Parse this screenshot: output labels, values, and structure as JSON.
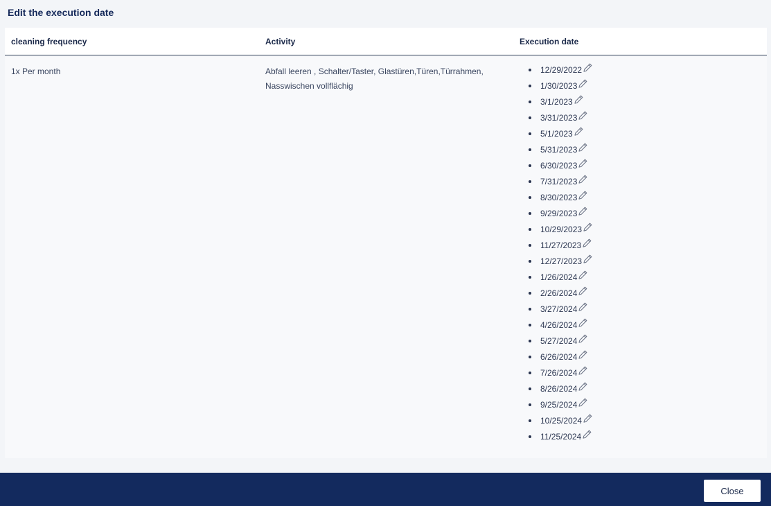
{
  "modal": {
    "title": "Edit the execution date"
  },
  "table": {
    "headers": {
      "frequency": "cleaning frequency",
      "activity": "Activity",
      "execution_date": "Execution date"
    },
    "row": {
      "frequency": "1x Per month",
      "activity_line1": "Abfall leeren , Schalter/Taster, Glastüren,Türen,Türrahmen,",
      "activity_line2": "Nasswischen vollflächig"
    },
    "dates": [
      "12/29/2022",
      "1/30/2023",
      "3/1/2023",
      "3/31/2023",
      "5/1/2023",
      "5/31/2023",
      "6/30/2023",
      "7/31/2023",
      "8/30/2023",
      "9/29/2023",
      "10/29/2023",
      "11/27/2023",
      "12/27/2023",
      "1/26/2024",
      "2/26/2024",
      "3/27/2024",
      "4/26/2024",
      "5/27/2024",
      "6/26/2024",
      "7/26/2024",
      "8/26/2024",
      "9/25/2024",
      "10/25/2024",
      "11/25/2024"
    ],
    "edit_icon": "pencil-icon"
  },
  "footer": {
    "close_label": "Close"
  },
  "colors": {
    "footer_bg": "#132a5e",
    "title": "#15295a"
  }
}
